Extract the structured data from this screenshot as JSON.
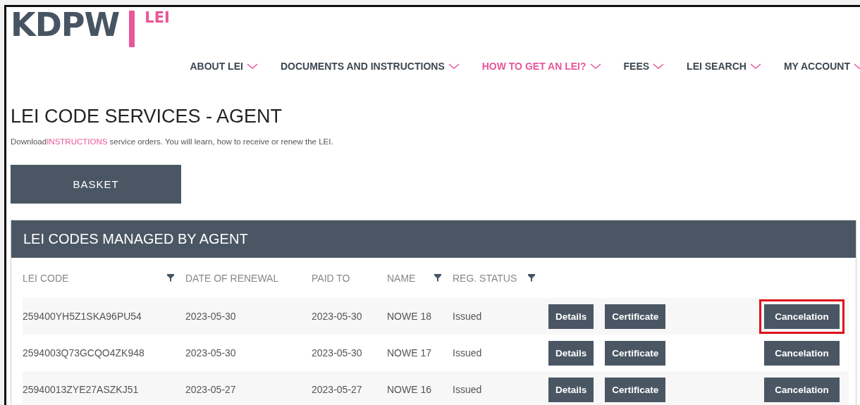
{
  "logo": {
    "brand": "KDPW",
    "product": "LEI"
  },
  "nav": [
    {
      "label": "ABOUT LEI",
      "selected": false
    },
    {
      "label": "DOCUMENTS AND INSTRUCTIONS",
      "selected": false
    },
    {
      "label": "HOW TO GET AN LEI?",
      "selected": true
    },
    {
      "label": "FEES",
      "selected": false
    },
    {
      "label": "LEI SEARCH",
      "selected": false
    },
    {
      "label": "MY ACCOUNT",
      "selected": false
    }
  ],
  "page_title": "LEI CODE SERVICES - AGENT",
  "intro": {
    "before": "Download",
    "link": "INSTRUCTIONS",
    "after": " service orders. You will learn, how to receive or renew the LEI."
  },
  "basket_button": "BASKET",
  "table": {
    "title": "LEI CODES MANAGED BY AGENT",
    "columns": [
      {
        "label": "LEI CODE",
        "filter": true
      },
      {
        "label": "DATE OF RENEWAL",
        "filter": false
      },
      {
        "label": "PAID TO",
        "filter": false
      },
      {
        "label": "NAME",
        "filter": true
      },
      {
        "label": "REG. STATUS",
        "filter": true
      }
    ],
    "rows": [
      {
        "lei_code": "259400YH5Z1SKA96PU54",
        "date_of_renewal": "2023-05-30",
        "paid_to": "2023-05-30",
        "name": "NOWE 18",
        "reg_status": "Issued",
        "details": "Details",
        "certificate": "Certificate",
        "cancelation": "Cancelation",
        "highlighted": true
      },
      {
        "lei_code": "2594003Q73GCQO4ZK948",
        "date_of_renewal": "2023-05-30",
        "paid_to": "2023-05-30",
        "name": "NOWE 17",
        "reg_status": "Issued",
        "details": "Details",
        "certificate": "Certificate",
        "cancelation": "Cancelation",
        "highlighted": false
      },
      {
        "lei_code": "25940013ZYE27ASZKJ51",
        "date_of_renewal": "2023-05-27",
        "paid_to": "2023-05-27",
        "name": "NOWE 16",
        "reg_status": "Issued",
        "details": "Details",
        "certificate": "Certificate",
        "cancelation": "Cancelation",
        "highlighted": false
      }
    ]
  }
}
